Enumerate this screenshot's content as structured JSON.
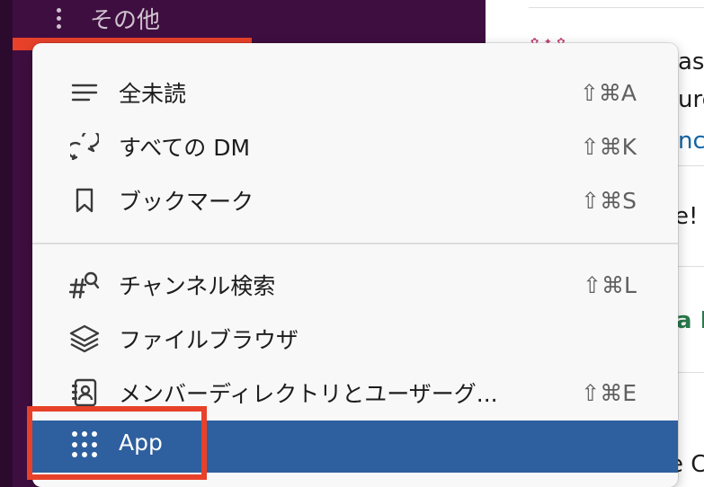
{
  "sidebar": {
    "more_label": "その他"
  },
  "message_pane": {
    "fragments": [
      "ase",
      "ure",
      "nc",
      "e! C",
      "a F",
      "e C"
    ]
  },
  "menu": {
    "group1": [
      {
        "label": "全未読",
        "shortcut": "⇧⌘A",
        "icon": "list-lines-icon"
      },
      {
        "label": "すべての DM",
        "shortcut": "⇧⌘K",
        "icon": "speech-bubbles-icon"
      },
      {
        "label": "ブックマーク",
        "shortcut": "⇧⌘S",
        "icon": "bookmark-icon"
      }
    ],
    "group2": [
      {
        "label": "チャンネル検索",
        "shortcut": "⇧⌘L",
        "icon": "channel-search-icon"
      },
      {
        "label": "ファイルブラウザ",
        "shortcut": "",
        "icon": "layers-icon"
      },
      {
        "label": "メンバーディレクトリとユーザーグ...",
        "shortcut": "⇧⌘E",
        "icon": "directory-icon"
      }
    ],
    "active": {
      "label": "App",
      "icon": "grid-dots-icon"
    }
  },
  "colors": {
    "sidebar": "#3f0e40",
    "highlight": "#e8412a",
    "active_row": "#2e5f9e"
  }
}
